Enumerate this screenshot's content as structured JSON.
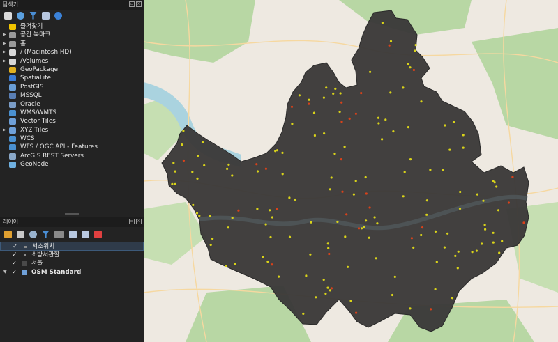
{
  "browser": {
    "title": "탐색기",
    "items": [
      {
        "label": "즐겨찾기",
        "icon": "star-icon",
        "color": "#f2c500",
        "arrow": false
      },
      {
        "label": "공간 북마크",
        "icon": "bookmark-icon",
        "color": "#9a9a9a",
        "arrow": true
      },
      {
        "label": "홈",
        "icon": "home-folder-icon",
        "color": "#9a9a9a",
        "arrow": true
      },
      {
        "label": "/ (Macintosh HD)",
        "icon": "folder-icon",
        "color": "#d8d8d8",
        "arrow": true
      },
      {
        "label": "/Volumes",
        "icon": "folder-icon",
        "color": "#d8d8d8",
        "arrow": true
      },
      {
        "label": "GeoPackage",
        "icon": "geopackage-icon",
        "color": "#e0b020",
        "arrow": false
      },
      {
        "label": "SpatiaLite",
        "icon": "spatialite-icon",
        "color": "#3a7bd5",
        "arrow": false
      },
      {
        "label": "PostGIS",
        "icon": "postgis-icon",
        "color": "#6a9fd8",
        "arrow": false
      },
      {
        "label": "MSSQL",
        "icon": "mssql-icon",
        "color": "#5a7fb5",
        "arrow": false
      },
      {
        "label": "Oracle",
        "icon": "oracle-icon",
        "color": "#7a9cc6",
        "arrow": false
      },
      {
        "label": "WMS/WMTS",
        "icon": "wms-globe-icon",
        "color": "#4a90d0",
        "arrow": false
      },
      {
        "label": "Vector Tiles",
        "icon": "vector-tiles-icon",
        "color": "#6fa0d8",
        "arrow": false
      },
      {
        "label": "XYZ Tiles",
        "icon": "xyz-tiles-icon",
        "color": "#6fa0d8",
        "arrow": true
      },
      {
        "label": "WCS",
        "icon": "wcs-globe-icon",
        "color": "#4a90d0",
        "arrow": false
      },
      {
        "label": "WFS / OGC API - Features",
        "icon": "wfs-globe-icon",
        "color": "#4a90d0",
        "arrow": false
      },
      {
        "label": "ArcGIS REST Servers",
        "icon": "arcgis-icon",
        "color": "#8aa8c8",
        "arrow": false
      },
      {
        "label": "GeoNode",
        "icon": "geonode-icon",
        "color": "#6fb0e0",
        "arrow": false
      }
    ]
  },
  "layers": {
    "title": "레이어",
    "items": [
      {
        "label": "서소위치",
        "symbol": "point-symbol-icon",
        "symbol_color": "#8a8a8a",
        "selected": true,
        "bold": false,
        "arrow": false
      },
      {
        "label": "소방서관할",
        "symbol": "point-symbol-icon",
        "symbol_color": "#8a8a8a",
        "selected": false,
        "bold": false,
        "arrow": false
      },
      {
        "label": "서울",
        "symbol": "polygon-symbol-icon",
        "symbol_color": "#4a4a4a",
        "selected": false,
        "bold": false,
        "arrow": false
      },
      {
        "label": "OSM Standard",
        "symbol": "xyz-tiles-icon",
        "symbol_color": "#6fa0d8",
        "selected": false,
        "bold": true,
        "arrow": true
      }
    ]
  },
  "colors": {
    "polygon_fill": "#3a3838",
    "point_yellow": "#d9d31a",
    "point_red": "#d9421a",
    "map_green": "#b8d7a4",
    "map_land": "#eee9e1",
    "river": "#aad3df"
  }
}
